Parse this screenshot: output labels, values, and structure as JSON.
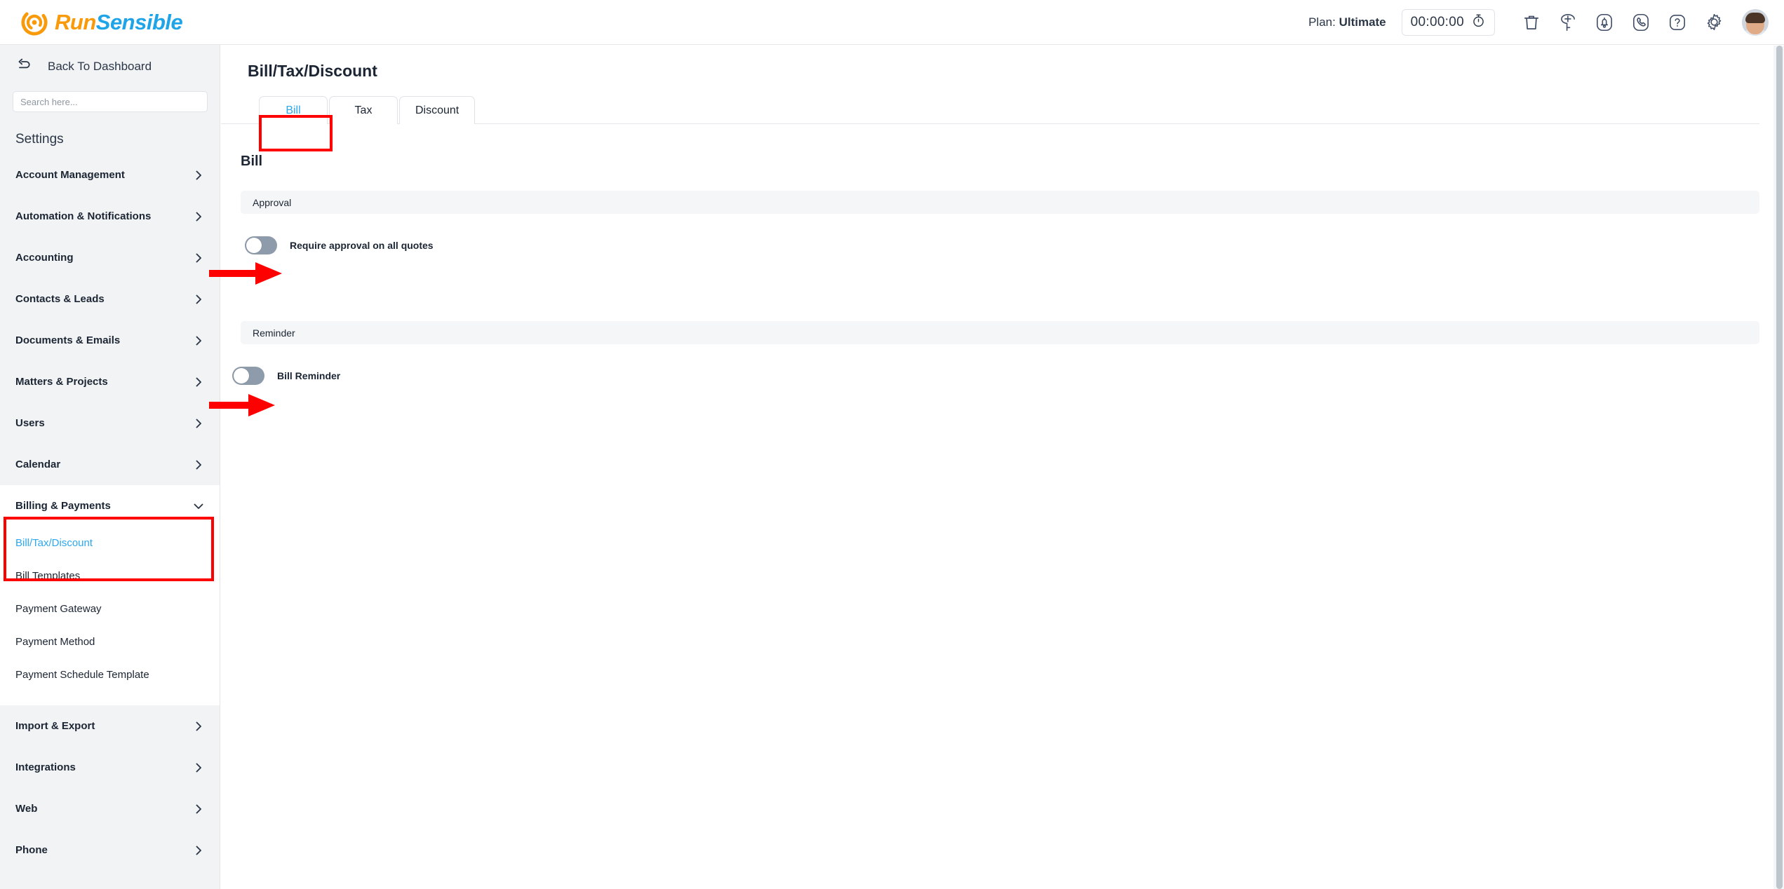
{
  "brand": {
    "name_part1": "Run",
    "name_part2": "Sensible",
    "logo_icon": "runsensible-spiral-icon",
    "color_orange": "#f99a0b",
    "color_blue": "#1fa4e8"
  },
  "header": {
    "plan_prefix": "Plan:",
    "plan_value": "Ultimate",
    "timer_value": "00:00:00",
    "icons": [
      {
        "name": "stopwatch-icon"
      },
      {
        "name": "trash-icon"
      },
      {
        "name": "add-circle-icon"
      },
      {
        "name": "bell-icon"
      },
      {
        "name": "phone-icon"
      },
      {
        "name": "help-question-icon"
      },
      {
        "name": "gear-icon"
      },
      {
        "name": "avatar"
      }
    ]
  },
  "sidebar": {
    "back_icon": "back-arrow-icon",
    "back_label": "Back To Dashboard",
    "search_placeholder": "Search here...",
    "search_value": "",
    "title": "Settings",
    "items": [
      {
        "label": "Account Management",
        "icon": "chevron-right-icon",
        "expanded": false
      },
      {
        "label": "Automation & Notifications",
        "icon": "chevron-right-icon",
        "expanded": false
      },
      {
        "label": "Accounting",
        "icon": "chevron-right-icon",
        "expanded": false
      },
      {
        "label": "Contacts & Leads",
        "icon": "chevron-right-icon",
        "expanded": false
      },
      {
        "label": "Documents & Emails",
        "icon": "chevron-right-icon",
        "expanded": false
      },
      {
        "label": "Matters & Projects",
        "icon": "chevron-right-icon",
        "expanded": false
      },
      {
        "label": "Users",
        "icon": "chevron-right-icon",
        "expanded": false
      },
      {
        "label": "Calendar",
        "icon": "chevron-right-icon",
        "expanded": false
      },
      {
        "label": "Billing & Payments",
        "icon": "chevron-down-icon",
        "expanded": true
      },
      {
        "label": "Import & Export",
        "icon": "chevron-right-icon",
        "expanded": false
      },
      {
        "label": "Integrations",
        "icon": "chevron-right-icon",
        "expanded": false
      },
      {
        "label": "Web",
        "icon": "chevron-right-icon",
        "expanded": false
      },
      {
        "label": "Phone",
        "icon": "chevron-right-icon",
        "expanded": false
      }
    ],
    "billing_subitems": [
      {
        "label": "Bill/Tax/Discount",
        "active": true
      },
      {
        "label": "Bill Templates",
        "active": false
      },
      {
        "label": "Payment Gateway",
        "active": false
      },
      {
        "label": "Payment Method",
        "active": false
      },
      {
        "label": "Payment Schedule Template",
        "active": false
      }
    ]
  },
  "main": {
    "page_title": "Bill/Tax/Discount",
    "tabs": [
      {
        "label": "Bill",
        "active": true
      },
      {
        "label": "Tax",
        "active": false
      },
      {
        "label": "Discount",
        "active": false
      }
    ],
    "section_heading": "Bill",
    "groups": [
      {
        "title": "Approval",
        "toggle_label": "Require approval on all quotes",
        "toggle_state": "off"
      },
      {
        "title": "Reminder",
        "toggle_label": "Bill Reminder",
        "toggle_state": "off"
      }
    ]
  },
  "annotations": {
    "highlight_color": "#ff0000",
    "boxes": [
      {
        "name": "sidebar-billing-highlight"
      },
      {
        "name": "bill-tab-highlight"
      }
    ],
    "arrows": [
      {
        "name": "arrow-to-approval-toggle"
      },
      {
        "name": "arrow-to-reminder-toggle"
      }
    ]
  }
}
